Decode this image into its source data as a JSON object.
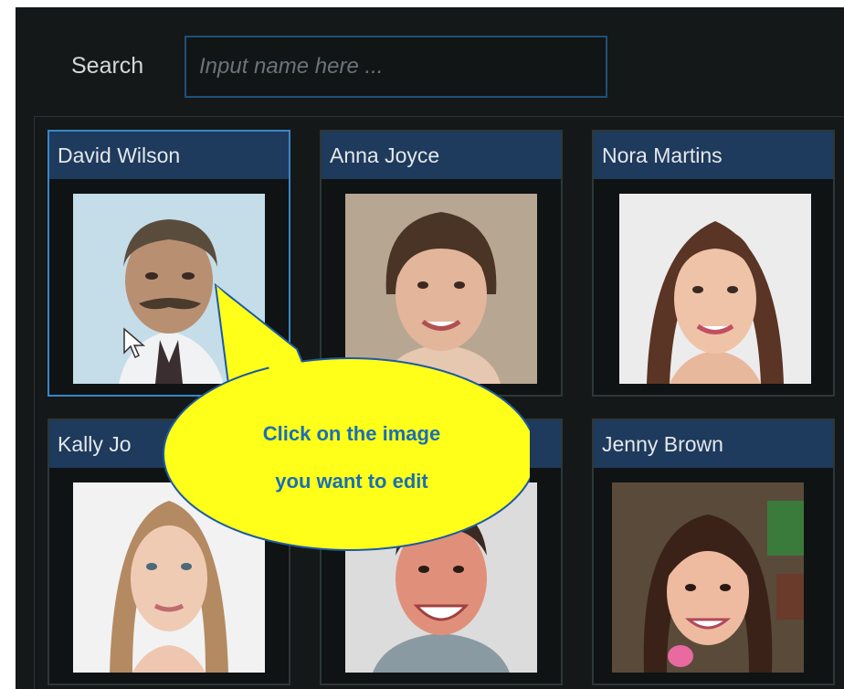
{
  "search": {
    "label": "Search",
    "placeholder": "Input name here ..."
  },
  "cards": [
    {
      "name": "David Wilson",
      "selected": true
    },
    {
      "name": "Anna Joyce"
    },
    {
      "name": "Nora Martins"
    },
    {
      "name": "Kally Jo"
    },
    {
      "name": ""
    },
    {
      "name": "Jenny Brown"
    }
  ],
  "callout": {
    "line1": "Click on the image",
    "line2": "you want to edit"
  },
  "colors": {
    "title_bar": "#1e3a5c",
    "selected_border": "#3a86c8",
    "callout_fill": "#ffff1a",
    "callout_text": "#1a6fb5"
  }
}
